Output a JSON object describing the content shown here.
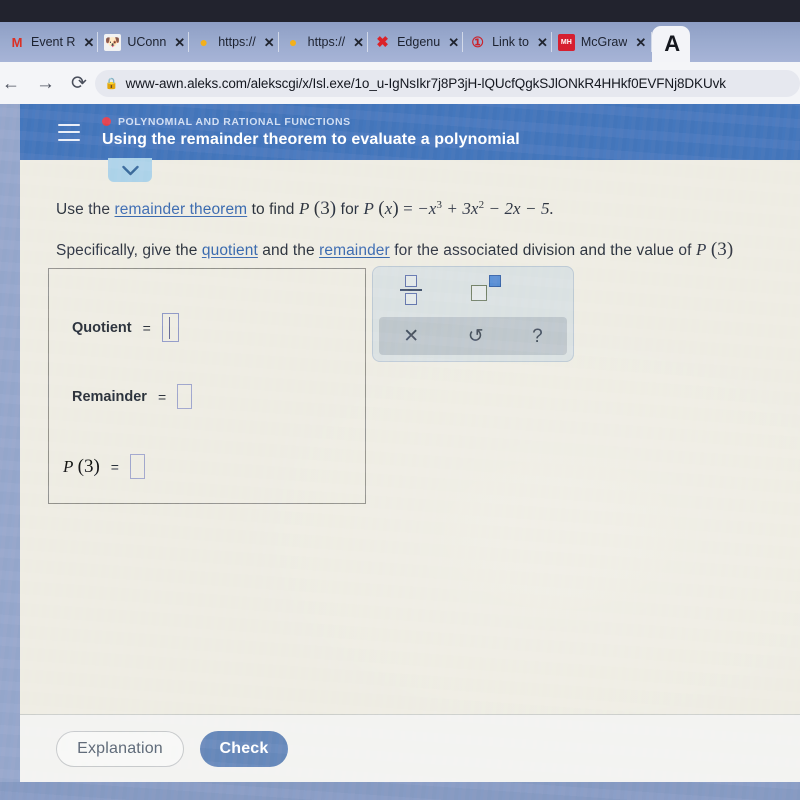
{
  "browser": {
    "tabs": [
      {
        "title": "Event R",
        "icon": "gmail-icon",
        "close_label": "✕"
      },
      {
        "title": "UConn",
        "icon": "uconn-icon",
        "close_label": "✕"
      },
      {
        "title": "https://",
        "icon": "bookmark-icon",
        "close_label": "✕"
      },
      {
        "title": "https://",
        "icon": "bookmark-icon",
        "close_label": "✕"
      },
      {
        "title": "Edgenu",
        "icon": "edgenuity-icon",
        "close_label": "✕"
      },
      {
        "title": "Link to",
        "icon": "blackboard-icon",
        "close_label": "✕"
      },
      {
        "title": "McGraw",
        "icon": "mcgraw-hill-icon",
        "close_label": "✕"
      }
    ],
    "active_tab_label": "A",
    "nav": {
      "back": "←",
      "forward": "→",
      "reload": "⟳"
    },
    "omnibox": {
      "lock": "🔒",
      "url": "www-awn.aleks.com/alekscgi/x/Isl.exe/1o_u-IgNsIkr7j8P3jH-lQUcfQgkSJlONkR4HHkf0EVFNj8DKUvk"
    }
  },
  "app": {
    "header": {
      "menu_icon": "hamburger-icon",
      "status_dot_color": "#e0343f",
      "kicker": "POLYNOMIAL AND RATIONAL FUNCTIONS",
      "title": "Using the remainder theorem to evaluate a polynomial"
    },
    "collapse_tab_icon": "chevron-down-icon",
    "question": {
      "line1": {
        "pre": "Use the ",
        "link1": "remainder theorem",
        "mid": " to find ",
        "p_of_3": "P (3)",
        "for": " for ",
        "px": "P (x)",
        "equals": " = ",
        "expr_t1": "−x",
        "expr_t1_exp": "3",
        "expr_t2": " + 3x",
        "expr_t2_exp": "2",
        "expr_t3": " − 2x − 5."
      },
      "line2": {
        "pre": "Specifically, give the ",
        "link1": "quotient",
        "mid1": " and the ",
        "link2": "remainder",
        "mid2": " for the associated division and the value of ",
        "tail": "P (3)"
      }
    },
    "answers": [
      {
        "label": "Quotient",
        "eq": "=",
        "value": "",
        "focused": true
      },
      {
        "label": "Remainder",
        "eq": "=",
        "value": "",
        "focused": false
      },
      {
        "label": "P (3)",
        "eq": "=",
        "value": "",
        "focused": false
      }
    ],
    "keypad": {
      "fraction_icon": "fraction-template-icon",
      "exponent_icon": "exponent-template-icon",
      "clear_label": "✕",
      "undo_label": "↺",
      "help_label": "?"
    },
    "footer": {
      "explanation_label": "Explanation",
      "check_label": "Check",
      "check_color": "#5f80b4"
    }
  }
}
